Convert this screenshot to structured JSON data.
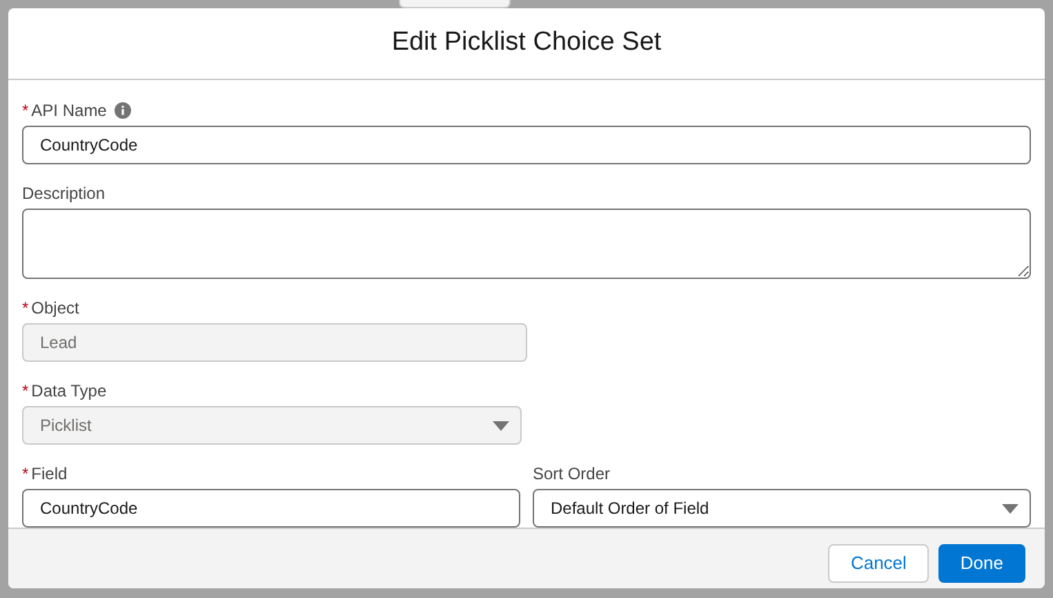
{
  "dialog": {
    "title": "Edit Picklist Choice Set"
  },
  "rows": [
    {
      "fields": [
        {
          "label": "API Name",
          "required_mark": "*",
          "info": true,
          "kind": "text",
          "value": "CountryCode",
          "disabled": false
        }
      ]
    },
    {
      "fields": [
        {
          "label": "Description",
          "kind": "textarea",
          "disabled": false
        }
      ]
    },
    {
      "fields": [
        {
          "label": "Object",
          "required_mark": "*",
          "kind": "text",
          "value": "Lead",
          "disabled": true
        }
      ]
    },
    {
      "fields": [
        {
          "label": "Data Type",
          "required_mark": "*",
          "kind": "select",
          "value": "Picklist",
          "disabled": true
        }
      ]
    },
    {
      "fields": [
        {
          "label": "Field",
          "required_mark": "*",
          "kind": "text",
          "value": "CountryCode",
          "disabled": false
        },
        {
          "label": "Sort Order",
          "kind": "select",
          "value": "Default Order of Field",
          "disabled": false
        }
      ]
    }
  ],
  "buttons": [
    {
      "label": "Cancel",
      "kind": "neutral"
    },
    {
      "label": "Done",
      "kind": "brand"
    }
  ]
}
